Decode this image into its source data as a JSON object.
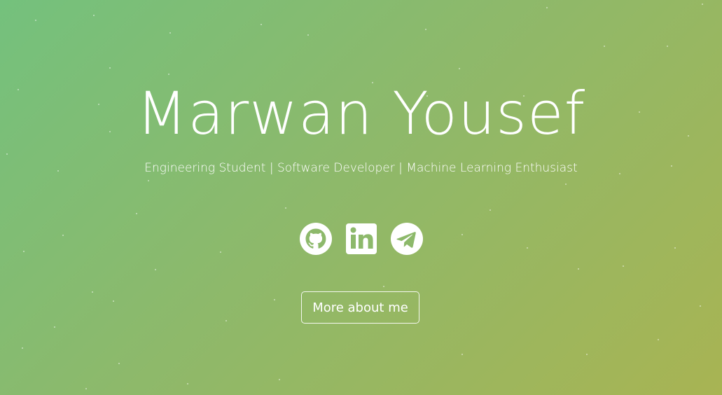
{
  "hero": {
    "name": "Marwan Yousef",
    "tagline": "Engineering Student | Software Developer | Machine Learning Enthusiast",
    "cta_label": "More about me"
  },
  "socials": [
    {
      "icon": "github-icon",
      "label": "GitHub"
    },
    {
      "icon": "linkedin-icon",
      "label": "LinkedIn"
    },
    {
      "icon": "telegram-icon",
      "label": "Telegram"
    }
  ],
  "colors": {
    "gradient_start": "#74c17d",
    "gradient_end": "#a8b453",
    "text": "#ffffff"
  }
}
